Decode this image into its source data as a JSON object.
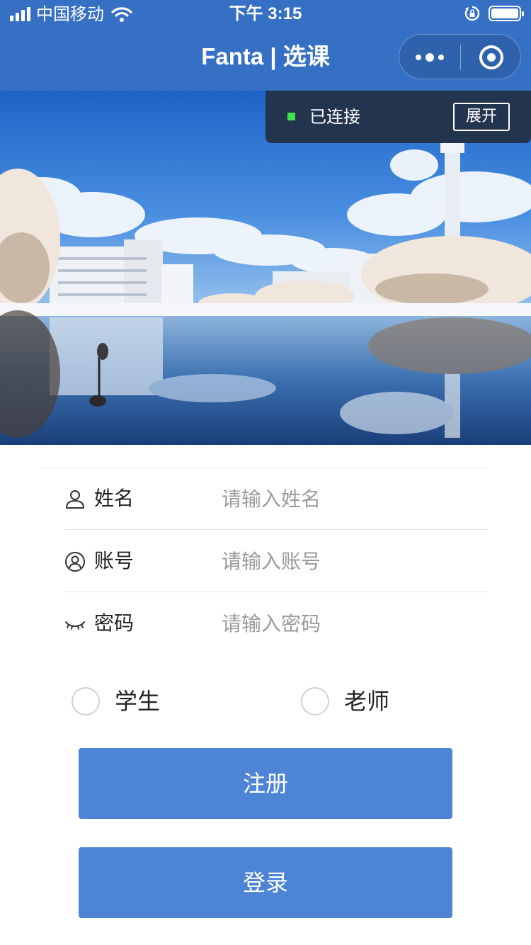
{
  "status_bar": {
    "carrier": "中国移动",
    "time": "下午 3:15"
  },
  "nav": {
    "title": "Fanta | 选课",
    "capsule_icons": [
      "more-dots-icon",
      "close-target-icon"
    ]
  },
  "connection": {
    "status_text": "已连接",
    "expand_label": "展开",
    "indicator_color": "#3fe24e"
  },
  "banner": {
    "description_icon": "campus-lake-photo"
  },
  "form": {
    "fields": [
      {
        "label": "姓名",
        "placeholder": "请输入姓名",
        "icon": "user-icon"
      },
      {
        "label": "账号",
        "placeholder": "请输入账号",
        "icon": "account-circle-icon"
      },
      {
        "label": "密码",
        "placeholder": "请输入密码",
        "icon": "closed-eye-icon"
      }
    ],
    "roles": [
      {
        "label": "学生",
        "checked": false
      },
      {
        "label": "老师",
        "checked": false
      }
    ],
    "register_label": "注册",
    "login_label": "登录"
  },
  "colors": {
    "nav_bg": "#3670c4",
    "button_bg": "#4d84d6",
    "popup_bg": "#23344f"
  }
}
